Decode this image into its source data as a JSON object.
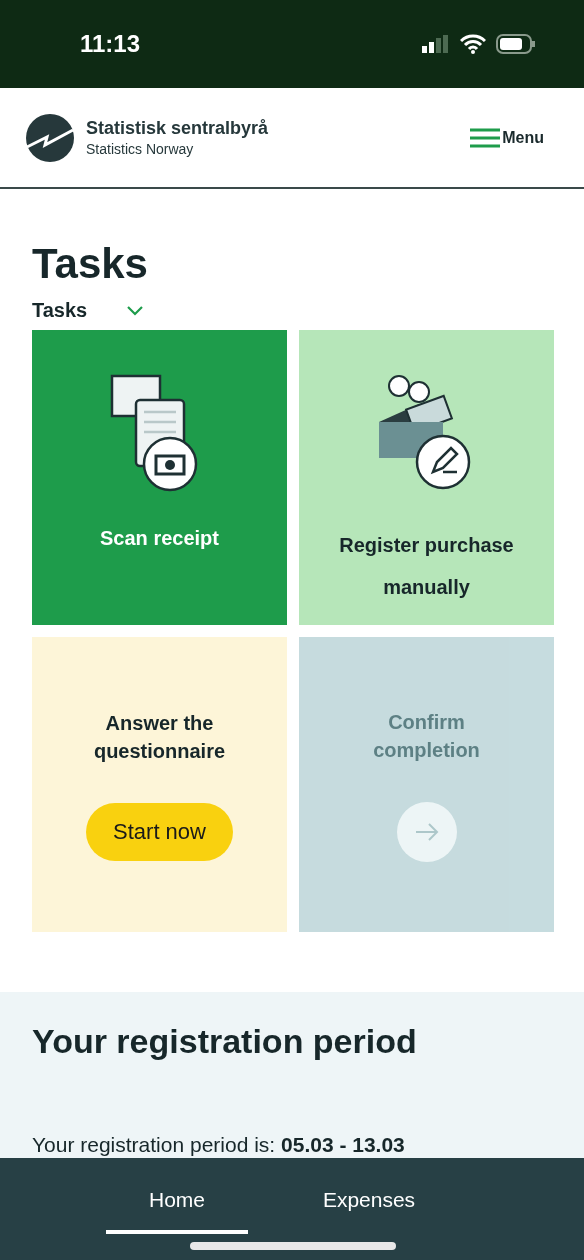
{
  "status_bar": {
    "time": "11:13"
  },
  "header": {
    "org_name": "Statistisk sentralbyrå",
    "org_subtitle": "Statistics Norway",
    "menu_label": "Menu"
  },
  "page": {
    "title": "Tasks",
    "filter": {
      "label": "Tasks",
      "expanded": false
    }
  },
  "cards": [
    {
      "kind": "illustrated",
      "title": "Scan receipt",
      "color": "#1e9c4b",
      "disabled": false
    },
    {
      "kind": "illustrated",
      "title": "Register purchase manually",
      "color": "#b6e6b9",
      "disabled": false
    },
    {
      "kind": "button",
      "title": "Answer the questionnaire",
      "button": "Start now",
      "color": "#fdf5d8",
      "disabled": false
    },
    {
      "kind": "arrow",
      "title": "Confirm completion",
      "color": "#c3dadd",
      "disabled": true
    }
  ],
  "registration": {
    "title": "Your registration period",
    "text": "Your registration period is: **05.03 - 13.03**"
  },
  "bottom_nav": [
    {
      "label": "Home",
      "selected": true
    },
    {
      "label": "Expenses",
      "selected": false
    }
  ]
}
